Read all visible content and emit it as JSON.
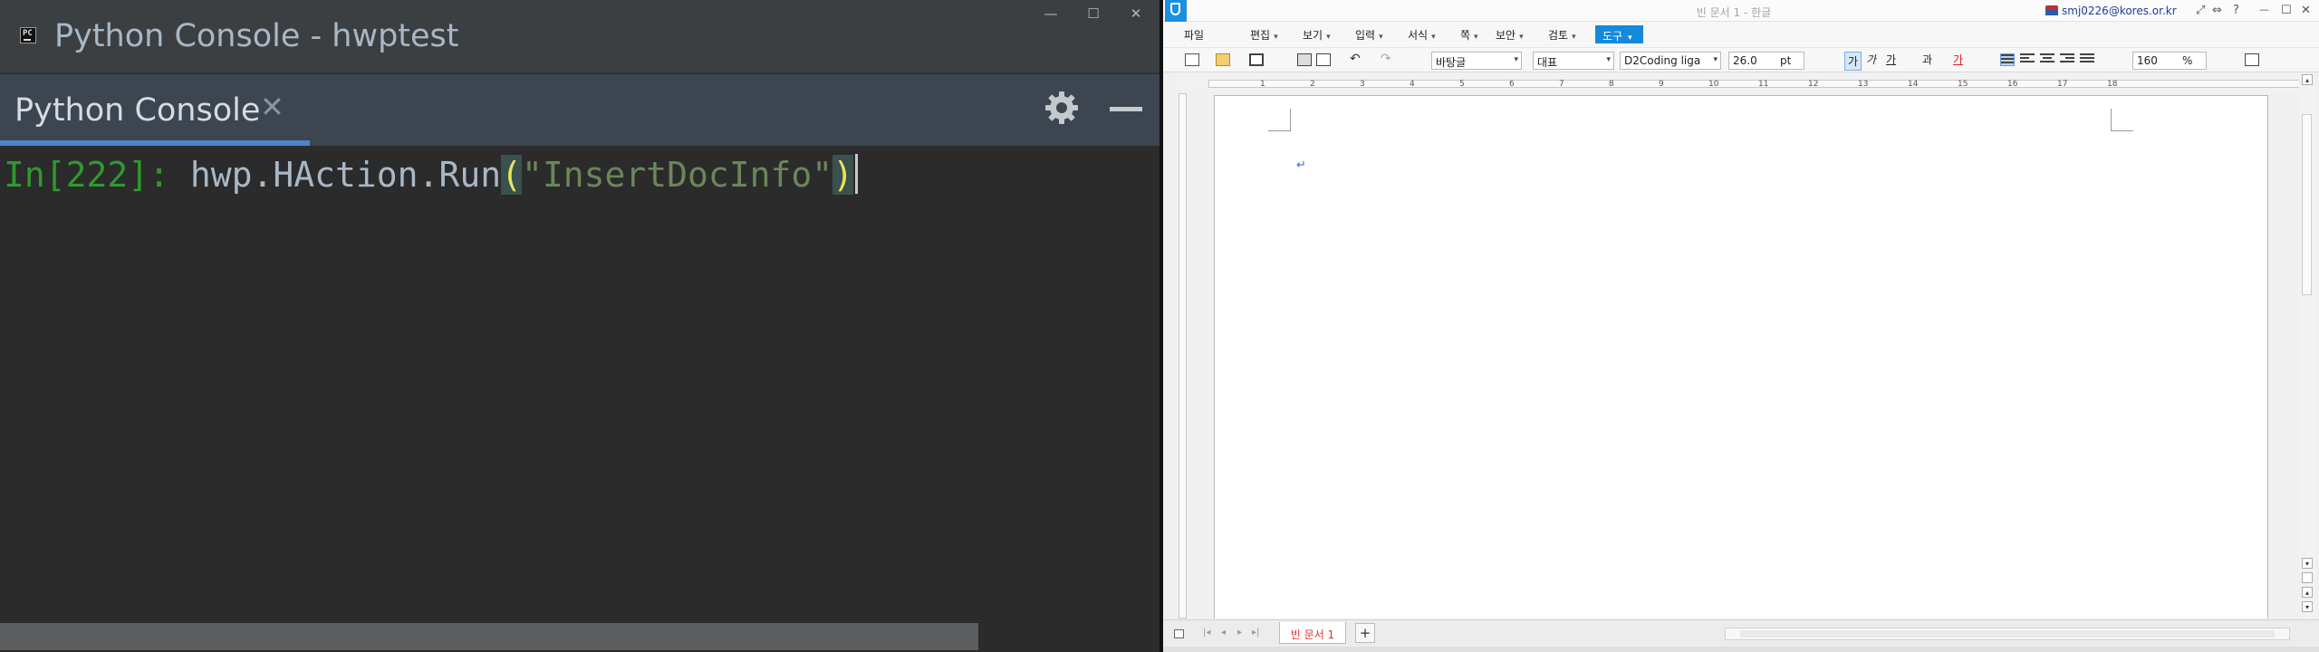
{
  "console": {
    "window_title": "Python Console - hwptest",
    "tab_label": "Python Console",
    "tab_close": "✕",
    "controls": {
      "minimize": "—",
      "maximize": "☐",
      "close": "✕"
    },
    "prompt": "In[222]: ",
    "code": {
      "prefix": "hwp.HAction.Run",
      "open_paren": "(",
      "string": "\"InsertDocInfo\"",
      "close_paren": ")"
    }
  },
  "hwp": {
    "window_title": "빈 문서 1 - 한글",
    "user_email": "smj0226@kores.or.kr",
    "title_icons": {
      "fullscreen": "⤢",
      "restore": "⇔",
      "help": "?",
      "minimize": "—",
      "maximize": "☐",
      "close": "✕"
    },
    "menu": [
      {
        "label": "파일",
        "arrow": ""
      },
      {
        "label": "편집",
        "arrow": "▾"
      },
      {
        "label": "보기",
        "arrow": "▾"
      },
      {
        "label": "입력",
        "arrow": "▾"
      },
      {
        "label": "서식",
        "arrow": "▾"
      },
      {
        "label": "쪽",
        "arrow": "▾"
      },
      {
        "label": "보안",
        "arrow": "▾"
      },
      {
        "label": "검토",
        "arrow": "▾"
      }
    ],
    "menu_active": {
      "label": "도구",
      "arrow": "▾"
    },
    "toolbar": {
      "undo": "↶",
      "redo": "↷",
      "style": "바탕글",
      "lang": "대표",
      "font": "D2Coding liga",
      "size": "26.0",
      "unit": "pt",
      "bold": "가",
      "italic": "가",
      "underline": "가",
      "strike": "과",
      "color": "가",
      "zoom": "160",
      "zoom_unit": "%"
    },
    "ruler_numbers": [
      "1",
      "2",
      "3",
      "4",
      "5",
      "6",
      "7",
      "8",
      "9",
      "10",
      "11",
      "12",
      "13",
      "14",
      "15",
      "16",
      "17",
      "18"
    ],
    "paragraph_mark": "↵",
    "status": {
      "tab": "빈 문서 1",
      "add_tab": "+",
      "nav": [
        "|◂",
        "◂",
        "▸",
        "▸|"
      ]
    },
    "colors": {
      "accent": "#1589dc",
      "tab_text": "#e23030",
      "console_prompt": "#2e9a2e",
      "console_string": "#6a8759"
    }
  }
}
